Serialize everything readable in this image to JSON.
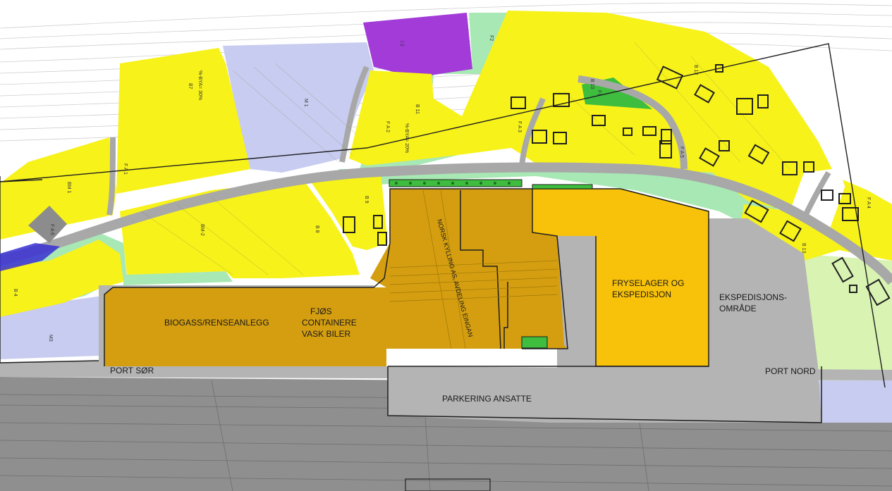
{
  "colors": {
    "background": "#ffffff",
    "residential": "#f7f21a",
    "green_area": "#a8e8b4",
    "light_blue_area": "#c8ccf0",
    "public_purple": "#a23bd8",
    "industry_dark": "#d49e10",
    "industry_light": "#f8c10a",
    "parking_grey": "#b4b4b4",
    "road_grey": "#a8a8a8",
    "railway_zone": "#8c8c8c",
    "play_area": "#3ebd3e",
    "light_green_area": "#d8f3b2"
  },
  "areas": {
    "biogass": "BIOGASS/RENSEANLEGG",
    "fjos_line1": "FJØS",
    "fjos_line2": "CONTAINERE",
    "fjos_line3": "VASK BILER",
    "fryselager_line1": "FRYSELAGER OG",
    "fryselager_line2": "EKSPEDISJON",
    "ekspedisjon_line1": "EKSPEDISJONS-",
    "ekspedisjon_line2": "OMRÅDE",
    "norsk_kylling": "NORSK KYLLING AS, AVDELING EINGAN",
    "parkering": "PARKERING ANSATTE",
    "port_sor": "PORT SØR",
    "port_nord": "PORT NORD"
  },
  "plan_codes": [
    "B7",
    "M 1",
    "I 2",
    "F2",
    "B 12",
    "B 11",
    "B 10",
    "BM 1",
    "BM-2",
    "B 8",
    "B 9",
    "B 4",
    "B 13",
    "M3",
    "F1",
    "F A 1",
    "F A 2",
    "F A 3",
    "F A 4",
    "F A 5",
    "F A 6",
    "%-BYA= 30%",
    "%-BYA= 20%"
  ]
}
